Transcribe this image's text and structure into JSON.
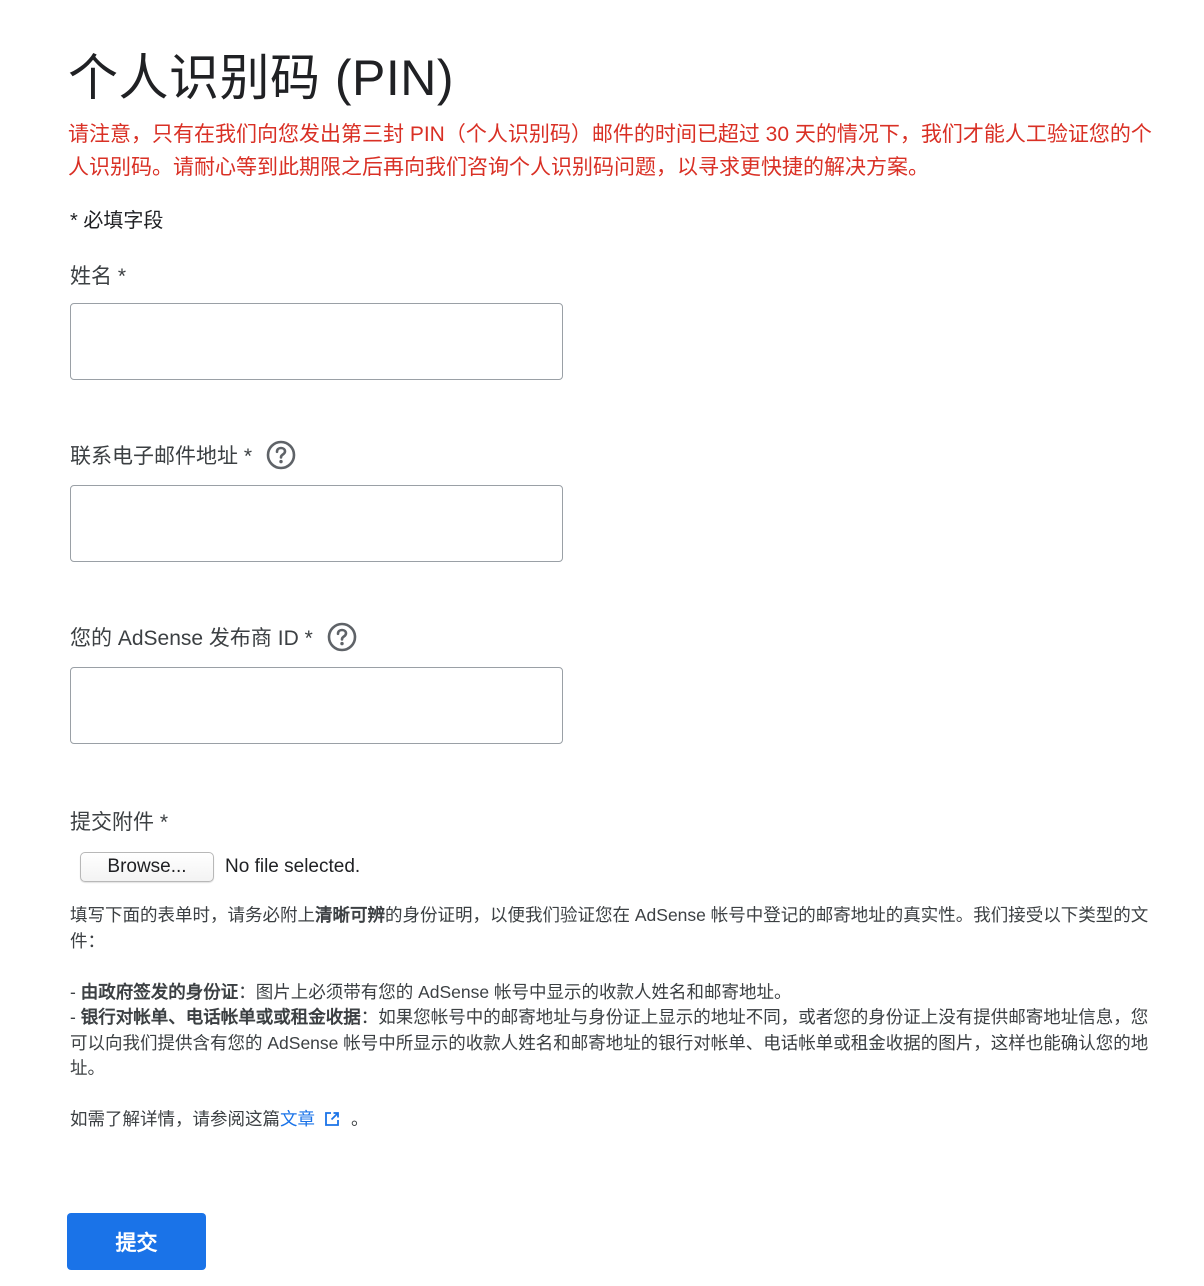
{
  "page": {
    "title": "个人识别码 (PIN)",
    "notice": "请注意，只有在我们向您发出第三封 PIN（个人识别码）邮件的时间已超过 30 天的情况下，我们才能人工验证您的个人识别码。请耐心等到此期限之后再向我们咨询个人识别码问题，以寻求更快捷的解决方案。",
    "required_note": "* 必填字段"
  },
  "form": {
    "name_label": "姓名 *",
    "name_value": "",
    "email_label": "联系电子邮件地址 *",
    "email_value": "",
    "publisher_id_label": "您的 AdSense 发布商 ID *",
    "publisher_id_value": "",
    "attachment_label": "提交附件 *",
    "browse_label": "Browse...",
    "file_status": "No file selected."
  },
  "info": {
    "intro_pre": "填写下面的表单时，请务必附上",
    "intro_bold": "清晰可辨",
    "intro_post": "的身份证明，以便我们验证您在 AdSense 帐号中登记的邮寄地址的真实性。我们接受以下类型的文件：",
    "item1_prefix": "- ",
    "item1_bold": "由政府签发的身份证",
    "item1_text": "：图片上必须带有您的 AdSense 帐号中显示的收款人姓名和邮寄地址。",
    "item2_prefix": "- ",
    "item2_bold": "银行对帐单、电话帐单或或租金收据",
    "item2_text": "：如果您帐号中的邮寄地址与身份证上显示的地址不同，或者您的身份证上没有提供邮寄地址信息，您可以向我们提供含有您的 AdSense 帐号中所显示的收款人姓名和邮寄地址的银行对帐单、电话帐单或租金收据的图片，这样也能确认您的地址。",
    "more_pre": "如需了解详情，请参阅这篇",
    "more_link": "文章",
    "more_post": "。"
  },
  "actions": {
    "submit_label": "提交"
  },
  "icons": {
    "help": "help-circle-icon",
    "external_link": "open-in-new-icon"
  },
  "colors": {
    "notice_red": "#d93025",
    "accent_blue": "#1a73e8"
  }
}
